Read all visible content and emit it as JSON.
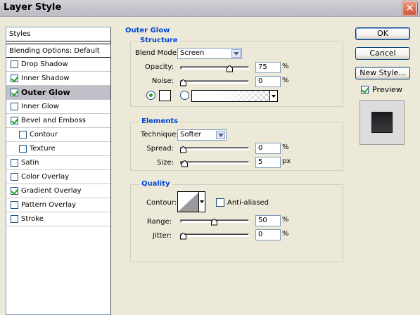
{
  "window": {
    "title": "Layer Style"
  },
  "styles": {
    "header": "Styles",
    "blending": "Blending Options: Default",
    "items": [
      {
        "label": "Drop Shadow",
        "checked": false,
        "sub": false,
        "selected": false
      },
      {
        "label": "Inner Shadow",
        "checked": true,
        "sub": false,
        "selected": false
      },
      {
        "label": "Outer Glow",
        "checked": true,
        "sub": false,
        "selected": true
      },
      {
        "label": "Inner Glow",
        "checked": false,
        "sub": false,
        "selected": false
      },
      {
        "label": "Bevel and Emboss",
        "checked": true,
        "sub": false,
        "selected": false
      },
      {
        "label": "Contour",
        "checked": false,
        "sub": true,
        "selected": false
      },
      {
        "label": "Texture",
        "checked": false,
        "sub": true,
        "selected": false
      },
      {
        "label": "Satin",
        "checked": false,
        "sub": false,
        "selected": false
      },
      {
        "label": "Color Overlay",
        "checked": false,
        "sub": false,
        "selected": false
      },
      {
        "label": "Gradient Overlay",
        "checked": true,
        "sub": false,
        "selected": false
      },
      {
        "label": "Pattern Overlay",
        "checked": false,
        "sub": false,
        "selected": false
      },
      {
        "label": "Stroke",
        "checked": false,
        "sub": false,
        "selected": false
      }
    ]
  },
  "outer_glow": {
    "title": "Outer Glow",
    "structure": {
      "title": "Structure",
      "blend_mode_label": "Blend Mode:",
      "blend_mode": "Screen",
      "opacity_label": "Opacity:",
      "opacity": "75",
      "opacity_level": 0.75,
      "opacity_unit": "%",
      "noise_label": "Noise:",
      "noise": "0",
      "noise_level": 0,
      "noise_unit": "%"
    },
    "elements": {
      "title": "Elements",
      "technique_label": "Technique:",
      "technique": "Softer",
      "spread_label": "Spread:",
      "spread": "0",
      "spread_level": 0,
      "spread_unit": "%",
      "size_label": "Size:",
      "size": "5",
      "size_level": 0.02,
      "size_unit": "px"
    },
    "quality": {
      "title": "Quality",
      "contour_label": "Contour:",
      "anti_aliased_label": "Anti-aliased",
      "anti_aliased": false,
      "range_label": "Range:",
      "range": "50",
      "range_level": 0.5,
      "range_unit": "%",
      "jitter_label": "Jitter:",
      "jitter": "0",
      "jitter_level": 0,
      "jitter_unit": "%"
    }
  },
  "buttons": {
    "ok": "OK",
    "cancel": "Cancel",
    "new_style": "New Style...",
    "preview_label": "Preview",
    "preview_checked": true
  },
  "colors": {
    "group_title": "#0046d5",
    "check": "#21a121",
    "selected_row": "#c0c0c8",
    "preview_swatch": "#2a2a2e"
  }
}
